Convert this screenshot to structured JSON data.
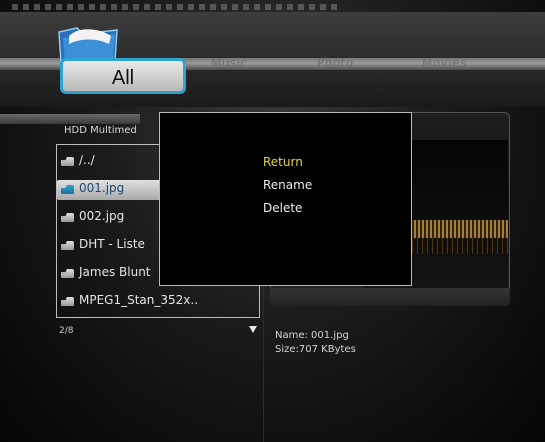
{
  "tabs": {
    "all": "All",
    "music": "Music",
    "photo": "Photo",
    "movies": "Movies"
  },
  "browser": {
    "breadcrumb": "HDD Multimed",
    "files": [
      {
        "label": "/../",
        "selected": false
      },
      {
        "label": "001.jpg",
        "selected": true
      },
      {
        "label": "002.jpg",
        "selected": false
      },
      {
        "label": "DHT - Liste",
        "selected": false
      },
      {
        "label": "James Blunt",
        "selected": false
      },
      {
        "label": "MPEG1_Stan_352x..",
        "selected": false
      }
    ],
    "page_count": "2/8"
  },
  "preview": {
    "name_text": "Name: 001.jpg",
    "size_text": "Size:707 KBytes"
  },
  "context_menu": {
    "items": [
      {
        "label": "Return",
        "active": true
      },
      {
        "label": "Rename",
        "active": false
      },
      {
        "label": "Delete",
        "active": false
      }
    ]
  },
  "colors": {
    "tab_border": "#2fa2cf",
    "menu_active": "#e8d53a"
  }
}
